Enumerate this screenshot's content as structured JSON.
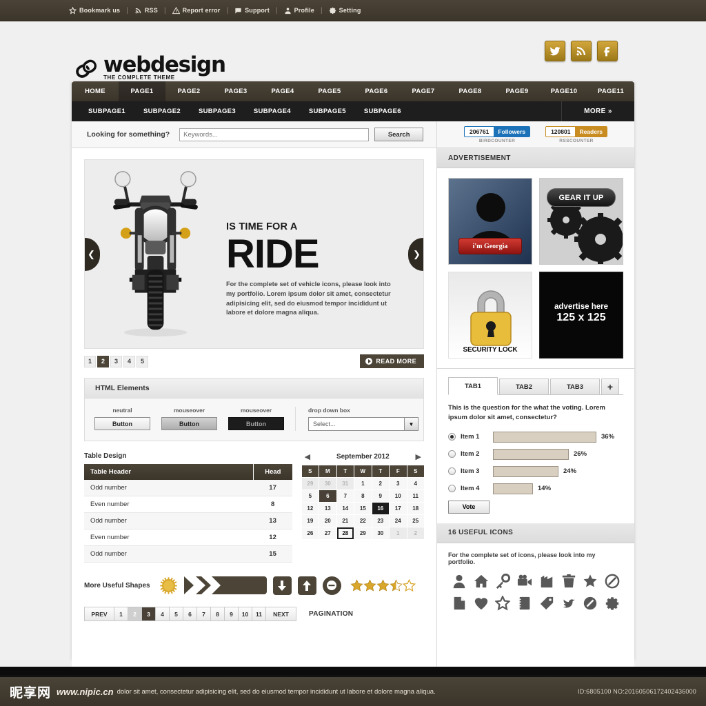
{
  "topbar": {
    "items": [
      {
        "icon": "star-icon",
        "label": "Bookmark us"
      },
      {
        "icon": "rss-icon",
        "label": "RSS"
      },
      {
        "icon": "warning-icon",
        "label": "Report error"
      },
      {
        "icon": "chat-icon",
        "label": "Support"
      },
      {
        "icon": "user-icon",
        "label": "Profile"
      },
      {
        "icon": "gear-icon",
        "label": "Setting"
      }
    ],
    "separator": "|"
  },
  "header": {
    "logo_text": "webdesign",
    "logo_sub": "THE COMPLETE THEME",
    "social": [
      {
        "icon": "bird-icon",
        "name": "twitter"
      },
      {
        "icon": "rss-icon",
        "name": "rss"
      },
      {
        "icon": "facebook-icon",
        "name": "facebook"
      }
    ]
  },
  "nav": {
    "main": [
      "HOME",
      "PAGE1",
      "PAGE2",
      "PAGE3",
      "PAGE4",
      "PAGE5",
      "PAGE6",
      "PAGE7",
      "PAGE8",
      "PAGE9",
      "PAGE10",
      "PAGE11"
    ],
    "active_index": 1,
    "sub": [
      "SUBPAGE1",
      "SUBPAGE2",
      "SUBPAGE3",
      "SUBPAGE4",
      "SUBPAGE5",
      "SUBPAGE6"
    ],
    "more": "MORE »"
  },
  "search": {
    "label": "Looking for something?",
    "placeholder": "Keywords...",
    "button": "Search"
  },
  "counters": [
    {
      "value": "206761",
      "label": "Followers",
      "caption": "BIRDCOUNTER",
      "color": "#1b72b8"
    },
    {
      "value": "120801",
      "label": "Readers",
      "caption": "RSSCOUNTER",
      "color": "#c98c20"
    }
  ],
  "slider": {
    "kicker": "IS TIME FOR A",
    "title": "RIDE",
    "description": "For the complete set of vehicle icons, please look into my portfolio. Lorem ipsum dolor sit amet, consectetur adipisicing elit, sed do eiusmod tempor incididunt ut labore et dolore magna aliqua.",
    "dots": [
      "1",
      "2",
      "3",
      "4",
      "5"
    ],
    "active_dot": 1,
    "read_more": "READ MORE",
    "prev_icon": "chevron-left-icon",
    "next_icon": "chevron-right-icon"
  },
  "html_elements": {
    "title": "HTML Elements",
    "buttons": [
      {
        "caption": "neutral",
        "label": "Button",
        "state": "neutral"
      },
      {
        "caption": "mouseover",
        "label": "Button",
        "state": "hover"
      },
      {
        "caption": "mouseover",
        "label": "Button",
        "state": "dark"
      }
    ],
    "dropdown": {
      "caption": "drop down box",
      "value": "Select..."
    }
  },
  "table": {
    "title": "Table Design",
    "headers": [
      "Table Header",
      "Head"
    ],
    "rows": [
      {
        "label": "Odd number",
        "value": "17"
      },
      {
        "label": "Even number",
        "value": "8"
      },
      {
        "label": "Odd number",
        "value": "13"
      },
      {
        "label": "Even number",
        "value": "12"
      },
      {
        "label": "Odd number",
        "value": "15"
      }
    ]
  },
  "calendar": {
    "title": "September 2012",
    "prev_icon": "triangle-left-icon",
    "next_icon": "triangle-right-icon",
    "dow": [
      "S",
      "M",
      "T",
      "W",
      "T",
      "F",
      "S"
    ],
    "cells": [
      {
        "d": "29",
        "t": "mut"
      },
      {
        "d": "30",
        "t": "mut"
      },
      {
        "d": "31",
        "t": "mut"
      },
      {
        "d": "1",
        "t": "day"
      },
      {
        "d": "2",
        "t": "day"
      },
      {
        "d": "3",
        "t": "day"
      },
      {
        "d": "4",
        "t": "day"
      },
      {
        "d": "5",
        "t": "day"
      },
      {
        "d": "6",
        "t": "sel"
      },
      {
        "d": "7",
        "t": "day"
      },
      {
        "d": "8",
        "t": "day"
      },
      {
        "d": "9",
        "t": "day"
      },
      {
        "d": "10",
        "t": "day"
      },
      {
        "d": "11",
        "t": "day"
      },
      {
        "d": "12",
        "t": "day"
      },
      {
        "d": "13",
        "t": "day"
      },
      {
        "d": "14",
        "t": "day"
      },
      {
        "d": "15",
        "t": "day"
      },
      {
        "d": "16",
        "t": "sel2"
      },
      {
        "d": "17",
        "t": "day"
      },
      {
        "d": "18",
        "t": "day"
      },
      {
        "d": "19",
        "t": "day"
      },
      {
        "d": "20",
        "t": "day"
      },
      {
        "d": "21",
        "t": "day"
      },
      {
        "d": "22",
        "t": "day"
      },
      {
        "d": "23",
        "t": "day"
      },
      {
        "d": "24",
        "t": "day"
      },
      {
        "d": "25",
        "t": "day"
      },
      {
        "d": "26",
        "t": "day"
      },
      {
        "d": "27",
        "t": "day"
      },
      {
        "d": "28",
        "t": "ring"
      },
      {
        "d": "29",
        "t": "day"
      },
      {
        "d": "30",
        "t": "day"
      },
      {
        "d": "1",
        "t": "mut"
      },
      {
        "d": "2",
        "t": "mut"
      }
    ]
  },
  "shapes": {
    "title": "More Useful Shapes",
    "items": [
      "starburst-badge-icon",
      "double-chevron-banner-icon",
      "arrow-down-icon",
      "arrow-up-icon",
      "minus-circle-icon"
    ],
    "rating": 3.5,
    "rating_max": 5
  },
  "pagination": {
    "prev": "PREV",
    "next": "NEXT",
    "pages": [
      "1",
      "2",
      "3",
      "4",
      "5",
      "6",
      "7",
      "8",
      "9",
      "10",
      "11"
    ],
    "current": "3",
    "hover": "2",
    "label": "PAGINATION"
  },
  "advertisement": {
    "title": "ADVERTISEMENT",
    "ads": [
      {
        "name": "georgia-profile-ad",
        "button": "i'm Georgia"
      },
      {
        "name": "gear-it-up-ad",
        "label": "GEAR IT UP"
      },
      {
        "name": "security-lock-ad",
        "caption": "SECURITY LOCK"
      },
      {
        "name": "advertise-here-ad",
        "line1": "advertise here",
        "line2": "125 x 125"
      }
    ]
  },
  "poll": {
    "tabs": [
      "TAB1",
      "TAB2",
      "TAB3"
    ],
    "add_tab": "+",
    "active_tab": 0,
    "question": "This is the question for the what the voting. Lorem ipsum dolor sit amet, consectetur?",
    "items": [
      {
        "label": "Item 1",
        "percent": "36%",
        "value": 36,
        "selected": true
      },
      {
        "label": "Item 2",
        "percent": "26%",
        "value": 26,
        "selected": false
      },
      {
        "label": "Item 3",
        "percent": "24%",
        "value": 24,
        "selected": false
      },
      {
        "label": "Item 4",
        "percent": "14%",
        "value": 14,
        "selected": false
      }
    ],
    "vote_button": "Vote"
  },
  "useful_icons": {
    "title": "16 USEFUL ICONS",
    "description": "For the complete set of icons, please look into my portfolio.",
    "icons": [
      "user-icon",
      "home-icon",
      "key-icon",
      "video-camera-icon",
      "building-icon",
      "trash-icon",
      "star-icon",
      "no-sign-icon",
      "page-icon",
      "heart-icon",
      "star-outline-icon",
      "notebook-icon",
      "tag-icon",
      "bird-icon",
      "ban-icon",
      "gear-icon"
    ]
  },
  "footer": {
    "watermark_cn": "昵享网",
    "watermark_url": "www.nipic.cn",
    "watermark_text": "dolor sit amet, consectetur adipisicing elit, sed do eiusmod tempor incididunt ut labore et dolore magna aliqua.",
    "id_text": "ID:6805100 NO:20160506172402436000"
  },
  "colors": {
    "brand_dark": "#4b4437",
    "gold": "#c9a23a",
    "accent_blue": "#1b72b8",
    "accent_orange": "#c98c20"
  }
}
